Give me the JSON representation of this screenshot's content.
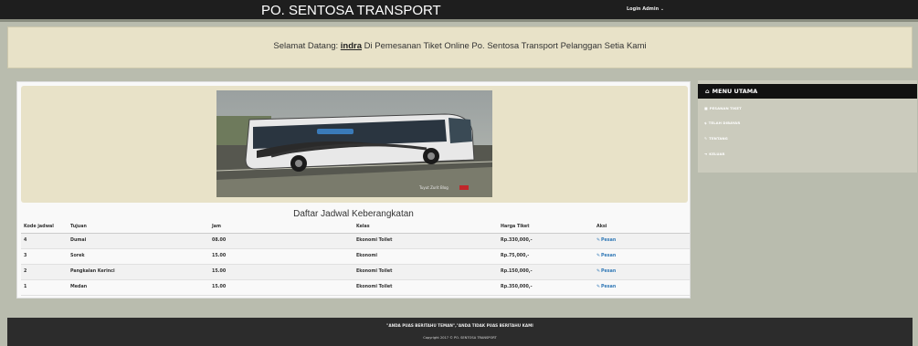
{
  "header": {
    "brand": "PO. SENTOSA TRANSPORT",
    "login": "Login Admin ⌄"
  },
  "welcome": {
    "prefix": "Selamat Datang: ",
    "user": "indra",
    "suffix": " Di Pemesanan Tiket Online Po. Sentosa Transport Pelanggan Setia Kami"
  },
  "hero": {
    "bus_photo_icon": "bus-photo",
    "watermark": "Tuyut Zurit Blog"
  },
  "schedule": {
    "title": "Daftar Jadwal Keberangkatan",
    "headers": [
      "Kode jadwal",
      "Tujuan",
      "Jam",
      "Kelas",
      "Harga Tiket",
      "Aksi"
    ],
    "rows": [
      {
        "kode": "4",
        "tujuan": "Dumai",
        "jam": "08.00",
        "kelas": "Ekonomi Toilet",
        "harga": "Rp.330,000,-",
        "aksi": "Pesan"
      },
      {
        "kode": "3",
        "tujuan": "Sorek",
        "jam": "15.00",
        "kelas": "Ekonomi",
        "harga": "Rp.75,000,-",
        "aksi": "Pesan"
      },
      {
        "kode": "2",
        "tujuan": "Pangkalan Kerinci",
        "jam": "15.00",
        "kelas": "Ekonomi Toilet",
        "harga": "Rp.150,000,-",
        "aksi": "Pesan"
      },
      {
        "kode": "1",
        "tujuan": "Medan",
        "jam": "15.00",
        "kelas": "Ekonomi Toilet",
        "harga": "Rp.350,000,-",
        "aksi": "Pesan"
      }
    ]
  },
  "sidebar": {
    "title": "MENU UTAMA",
    "items": [
      {
        "label": "PESANAN TIKET",
        "icon": "cart-icon"
      },
      {
        "label": "TELAH DIBAYAR",
        "icon": "dollar-icon"
      },
      {
        "label": "TENTANG",
        "icon": "pencil-icon"
      },
      {
        "label": "KELUAR",
        "icon": "logout-icon"
      }
    ]
  },
  "footer": {
    "slogan": "\"ANDA PUAS BERITAHU TEMAN\",\"ANDA TIDAK PUAS BERITAHU KAMI",
    "copyright": "Copyright 2017 © PO. SENTOSA TRANSPORT"
  }
}
